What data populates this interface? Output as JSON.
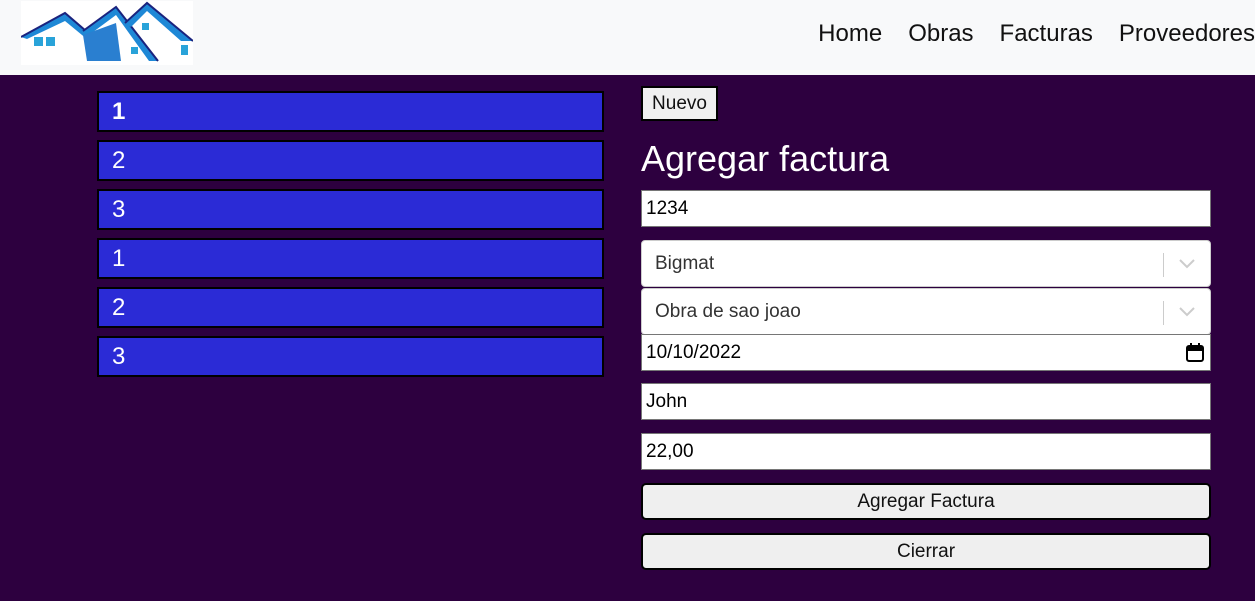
{
  "nav": {
    "links": [
      "Home",
      "Obras",
      "Facturas",
      "Proveedores"
    ]
  },
  "icons": {
    "logo": "houses-logo",
    "select_indicator": "chevron-down-icon",
    "date_picker": "calendar-icon"
  },
  "colors": {
    "background": "#2d003f",
    "navbar": "#f8f9fa",
    "list_item": "#2b2bd6",
    "logo_blue": "#1e88d6",
    "logo_navy": "#1a237e"
  },
  "list": {
    "items": [
      "1",
      "2",
      "3",
      "1",
      "2",
      "3"
    ]
  },
  "form": {
    "new_button": "Nuevo",
    "title": "Agregar factura",
    "number_value": "1234",
    "provider_value": "Bigmat",
    "work_value": "Obra de sao joao",
    "date_value": "10/10/2022",
    "name_value": "John",
    "amount_value": "22,00",
    "submit_label": "Agregar Factura",
    "close_label": "Cierrar"
  }
}
